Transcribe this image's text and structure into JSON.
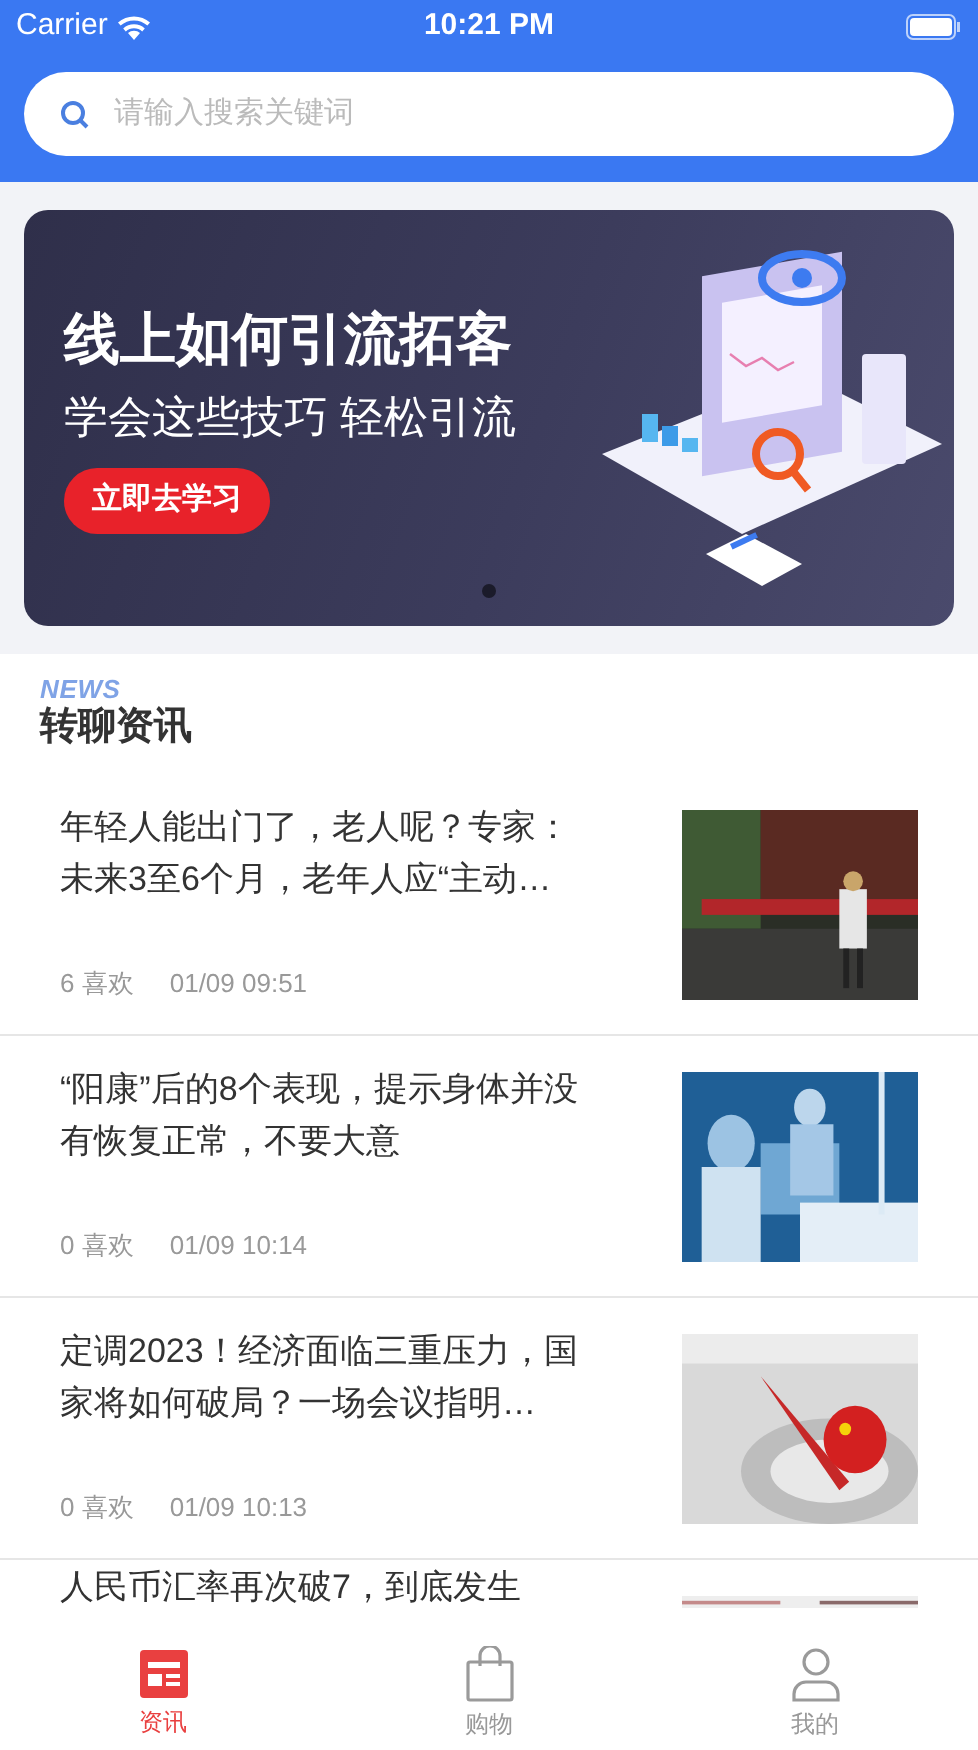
{
  "status_bar": {
    "carrier": "Carrier",
    "time": "10:21 PM"
  },
  "search": {
    "placeholder": "请输入搜索关键词"
  },
  "banner": {
    "title": "线上如何引流拓客",
    "subtitle": "学会这些技巧 轻松引流",
    "button": "立即去学习",
    "dots": [
      {
        "selected": true
      }
    ]
  },
  "section": {
    "decoration": "NEWS",
    "title": "转聊资讯"
  },
  "articles": [
    {
      "title": "年轻人能出门了，老人呢？专家：未来3至6个月，老年人应“主动…",
      "likes": "6",
      "likes_label": "喜欢",
      "time": "01/09 09:51",
      "kind": "street"
    },
    {
      "title": "“阳康”后的8个表现，提示身体并没有恢复正常，不要大意",
      "likes": "0",
      "likes_label": "喜欢",
      "time": "01/09 10:14",
      "kind": "medical"
    },
    {
      "title": "定调2023！经济面临三重压力，国家将如何破局？一场会议指明…",
      "likes": "0",
      "likes_label": "喜欢",
      "time": "01/09 10:13",
      "kind": "compass"
    },
    {
      "title": "人民币汇率再次破7，到底发生",
      "kind": "partial"
    }
  ],
  "tabs": [
    {
      "label": "资讯",
      "selected": true
    },
    {
      "label": "购物",
      "selected": false
    },
    {
      "label": "我的",
      "selected": false
    }
  ]
}
